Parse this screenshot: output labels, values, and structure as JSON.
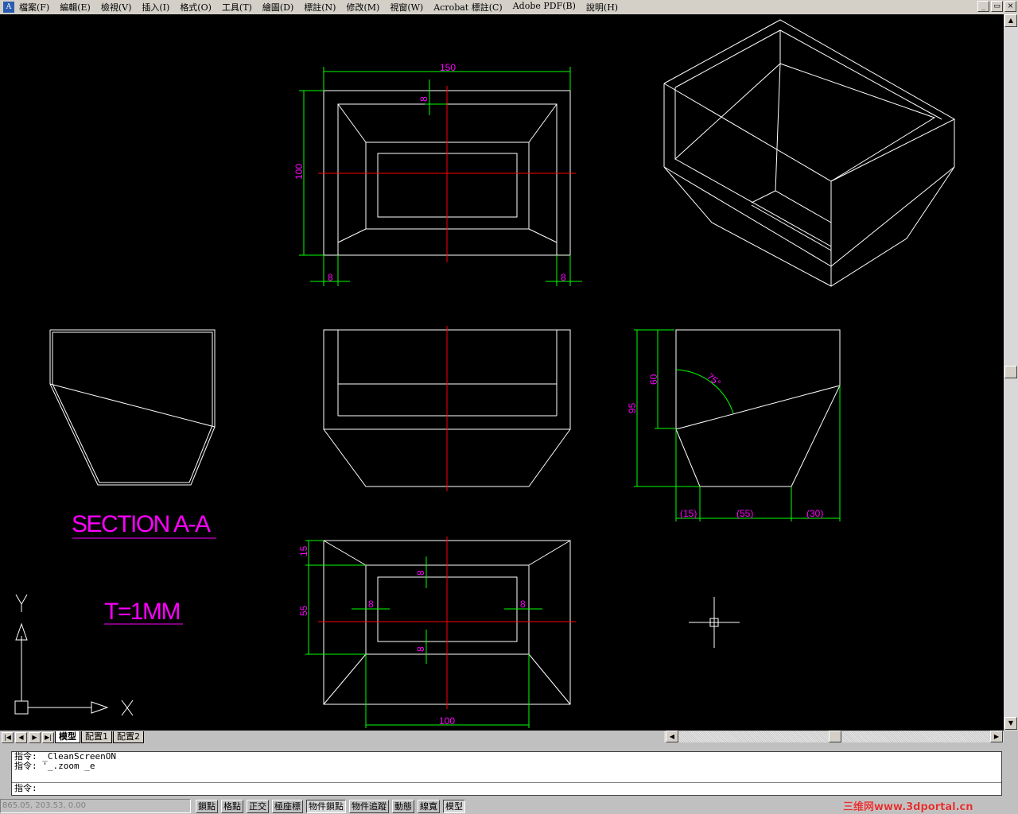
{
  "menu": [
    "檔案(F)",
    "編輯(E)",
    "檢視(V)",
    "插入(I)",
    "格式(O)",
    "工具(T)",
    "繪圖(D)",
    "標註(N)",
    "修改(M)",
    "視窗(W)",
    "Acrobat 標註(C)",
    "Adobe PDF(B)",
    "說明(H)"
  ],
  "window_buttons": [
    "_",
    "▭",
    "×"
  ],
  "drawing": {
    "dims_top": {
      "width": "150",
      "height": "100",
      "wall_top": "8",
      "wall_left": "8",
      "wall_right": "8"
    },
    "dims_side": {
      "h1": "95",
      "h2": "60",
      "angle": "75°",
      "b1": "(15)",
      "b2": "(55)",
      "b3": "(30)"
    },
    "dims_bottom": {
      "h1": "15",
      "h2": "55",
      "w": "100",
      "t1": "8",
      "t2": "8",
      "t3": "8",
      "t4": "8"
    },
    "section_label": "SECTION A-A",
    "thickness_label": "T=1MM",
    "ucs": {
      "x": "X",
      "y": "Y"
    },
    "colors": {
      "background": "#000000",
      "geometry": "#ffffff",
      "dimension": "#00ff00",
      "dim_text": "#ff00ff",
      "centerline": "#ff0000"
    }
  },
  "tabs": [
    "模型",
    "配置1",
    "配置2"
  ],
  "command": {
    "lines": [
      "指令: _CleanScreenON",
      "指令: '_.zoom _e"
    ],
    "prompt": "指令:"
  },
  "status": {
    "coords": "865.05, 203.53, 0.00",
    "buttons": [
      {
        "label": "鎖點",
        "on": false
      },
      {
        "label": "格點",
        "on": false
      },
      {
        "label": "正交",
        "on": false
      },
      {
        "label": "極座標",
        "on": false
      },
      {
        "label": "物件鎖點",
        "on": true
      },
      {
        "label": "物件追蹤",
        "on": false
      },
      {
        "label": "動態",
        "on": false
      },
      {
        "label": "線寬",
        "on": false
      },
      {
        "label": "模型",
        "on": true
      }
    ]
  },
  "watermark": "三维网www.3dportal.cn"
}
